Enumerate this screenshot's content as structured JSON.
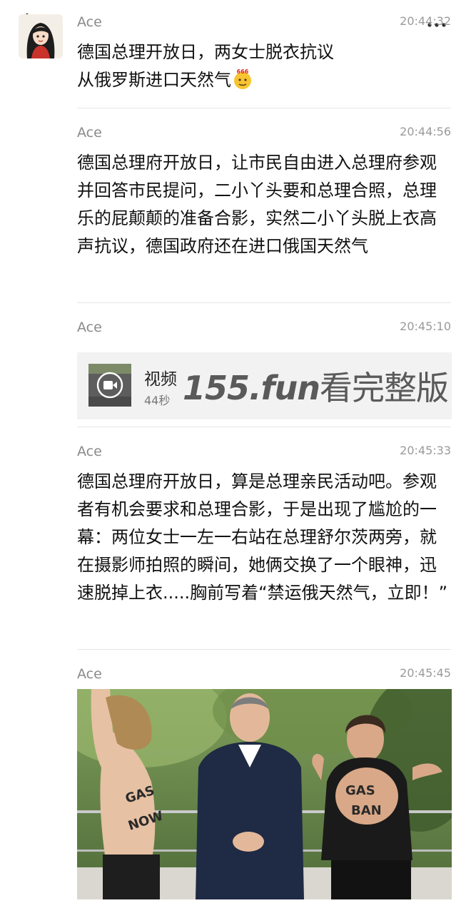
{
  "messages": [
    {
      "sender": "Ace",
      "time": "20:44:32",
      "text": "德国总理开放日，两女士脱衣抗议从俄罗斯进口天然气"
    },
    {
      "sender": "Ace",
      "time": "20:44:56",
      "text": "德国总理府开放日，让市民自由进入总理府参观并回答市民提问，二小丫头要和总理合照，总理乐的屁颠颠的准备合影，实然二小丫头脱上衣高声抗议，德国政府还在进口俄国天然气"
    },
    {
      "sender": "Ace",
      "time": "20:45:10",
      "video": {
        "label": "视频",
        "duration": "44秒",
        "watermark_domain": "155.fun",
        "watermark_text": "看完整版"
      }
    },
    {
      "sender": "Ace",
      "time": "20:45:33",
      "text": "德国总理府开放日，算是总理亲民活动吧。参观者有机会要求和总理合影，于是出现了尴尬的一幕：两位女士一左一右站在总理舒尔茨两旁，就在摄影师拍照的瞬间，她俩交换了一个眼神，迅速脱掉上衣.....胸前写着“禁运俄天然气，立即！”"
    },
    {
      "sender": "Ace",
      "time": "20:45:45"
    }
  ],
  "icons": {
    "back": "chevron-left-icon",
    "more": "more-dots-icon",
    "emoji": "666-emoji-icon",
    "play": "video-camera-icon"
  },
  "colors": {
    "timestamp": "#9a9a9a",
    "sender": "#8a8a8a",
    "card_bg": "#f2f2f2",
    "separator": "#e6e6e6"
  }
}
